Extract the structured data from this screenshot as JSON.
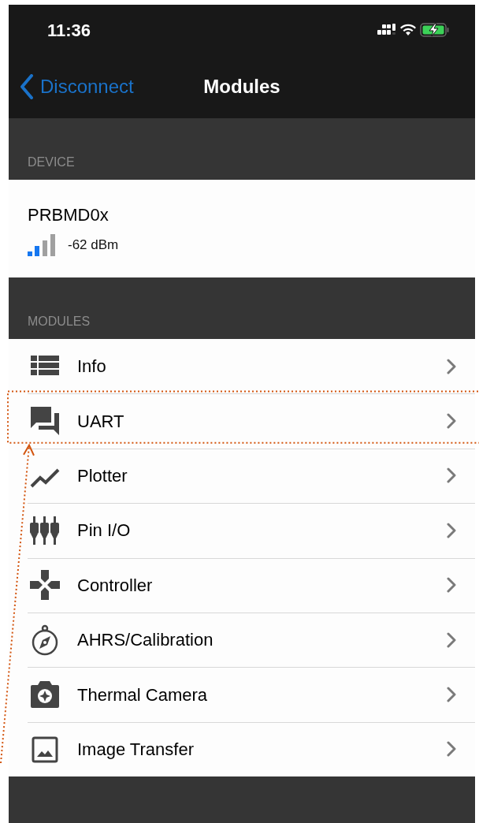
{
  "status_bar": {
    "time": "11:36"
  },
  "nav": {
    "back": "Disconnect",
    "title": "Modules"
  },
  "sections": [
    {
      "header": "DEVICE"
    },
    {
      "header": "MODULES"
    }
  ],
  "device": {
    "name": "PRBMD0x",
    "rssi": "-62 dBm"
  },
  "modules": [
    {
      "label": "Info",
      "highlighted": false
    },
    {
      "label": "UART",
      "highlighted": true
    },
    {
      "label": "Plotter",
      "highlighted": false
    },
    {
      "label": "Pin I/O",
      "highlighted": false
    },
    {
      "label": "Controller",
      "highlighted": false
    },
    {
      "label": "AHRS/Calibration",
      "highlighted": false
    },
    {
      "label": "Thermal Camera",
      "highlighted": false
    },
    {
      "label": "Image Transfer",
      "highlighted": false
    }
  ]
}
